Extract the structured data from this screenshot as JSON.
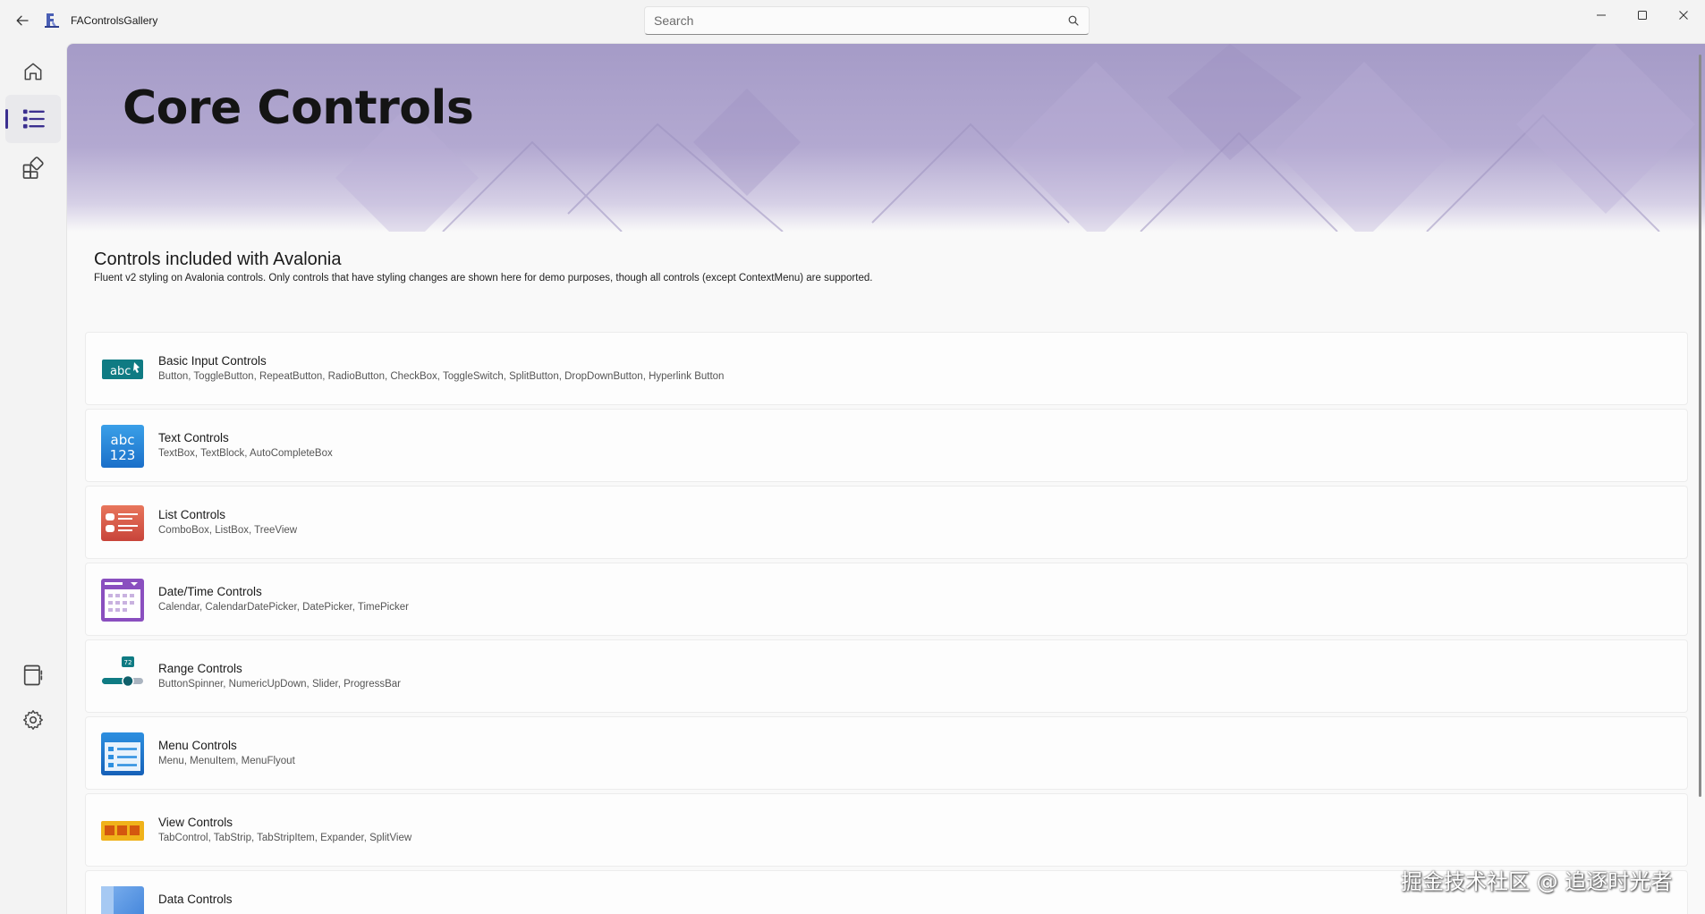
{
  "window": {
    "app_title": "FAControlsGallery",
    "search_placeholder": "Search",
    "accent_color": "#3b2f8f"
  },
  "nav": {
    "items": [
      {
        "name": "home",
        "icon": "home-icon"
      },
      {
        "name": "core-controls",
        "icon": "list-icon",
        "selected": true
      },
      {
        "name": "fa-controls",
        "icon": "add-apps-icon"
      }
    ],
    "footer_items": [
      {
        "name": "resources",
        "icon": "document-icon"
      },
      {
        "name": "settings",
        "icon": "gear-icon"
      }
    ]
  },
  "hero": {
    "title": "Core Controls",
    "color": "#a59bc7"
  },
  "section": {
    "title": "Controls included with Avalonia",
    "description": "Fluent v2 styling on Avalonia controls. Only controls that have styling changes are shown here for demo purposes, though all controls (except ContextMenu) are supported."
  },
  "categories": [
    {
      "title": "Basic Input Controls",
      "subtitle": "Button, ToggleButton, RepeatButton, RadioButton, CheckBox, ToggleSwitch, SplitButton, DropDownButton, Hyperlink Button",
      "icon": "basic-input-icon",
      "icon_text": "abc"
    },
    {
      "title": "Text Controls",
      "subtitle": "TextBox, TextBlock, AutoCompleteBox",
      "icon": "text-controls-icon",
      "icon_text": "abc 123"
    },
    {
      "title": "List Controls",
      "subtitle": "ComboBox, ListBox, TreeView",
      "icon": "list-controls-icon"
    },
    {
      "title": "Date/Time Controls",
      "subtitle": "Calendar, CalendarDatePicker, DatePicker, TimePicker",
      "icon": "calendar-icon"
    },
    {
      "title": "Range Controls",
      "subtitle": "ButtonSpinner, NumericUpDown, Slider, ProgressBar",
      "icon": "range-controls-icon",
      "icon_text": "72"
    },
    {
      "title": "Menu Controls",
      "subtitle": "Menu, MenuItem, MenuFlyout",
      "icon": "menu-controls-icon"
    },
    {
      "title": "View Controls",
      "subtitle": "TabControl, TabStrip, TabStripItem, Expander, SplitView",
      "icon": "view-controls-icon"
    },
    {
      "title": "Data Controls",
      "subtitle": "",
      "icon": "data-controls-icon"
    }
  ],
  "watermark": "掘金技术社区 @ 追逐时光者"
}
